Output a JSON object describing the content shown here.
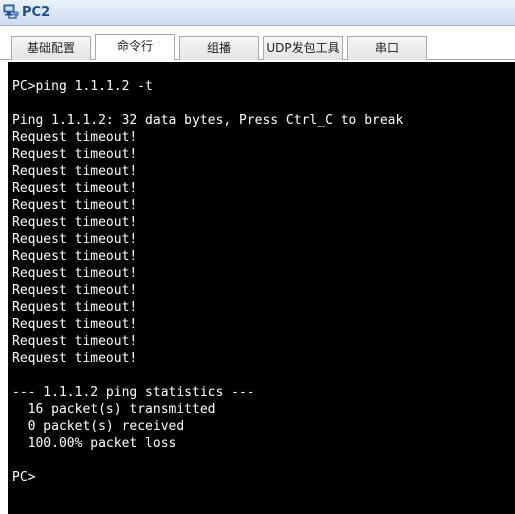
{
  "window": {
    "title": "PC2",
    "icon": "pc-network-icon"
  },
  "tabs": [
    {
      "label": "基础配置",
      "active": false
    },
    {
      "label": "命令行",
      "active": true
    },
    {
      "label": "组播",
      "active": false
    },
    {
      "label": "UDP发包工具",
      "active": false
    },
    {
      "label": "串口",
      "active": false
    }
  ],
  "terminal": {
    "lines": [
      "PC>ping 1.1.1.2 -t",
      "",
      "Ping 1.1.1.2: 32 data bytes, Press Ctrl_C to break",
      "Request timeout!",
      "Request timeout!",
      "Request timeout!",
      "Request timeout!",
      "Request timeout!",
      "Request timeout!",
      "Request timeout!",
      "Request timeout!",
      "Request timeout!",
      "Request timeout!",
      "Request timeout!",
      "Request timeout!",
      "Request timeout!",
      "Request timeout!",
      "",
      "--- 1.1.1.2 ping statistics ---",
      "  16 packet(s) transmitted",
      "  0 packet(s) received",
      "  100.00% packet loss",
      "",
      "PC>"
    ]
  },
  "colors": {
    "terminal_bg": "#000000",
    "terminal_fg": "#ffffff",
    "title_fg": "#1c4e8a"
  }
}
